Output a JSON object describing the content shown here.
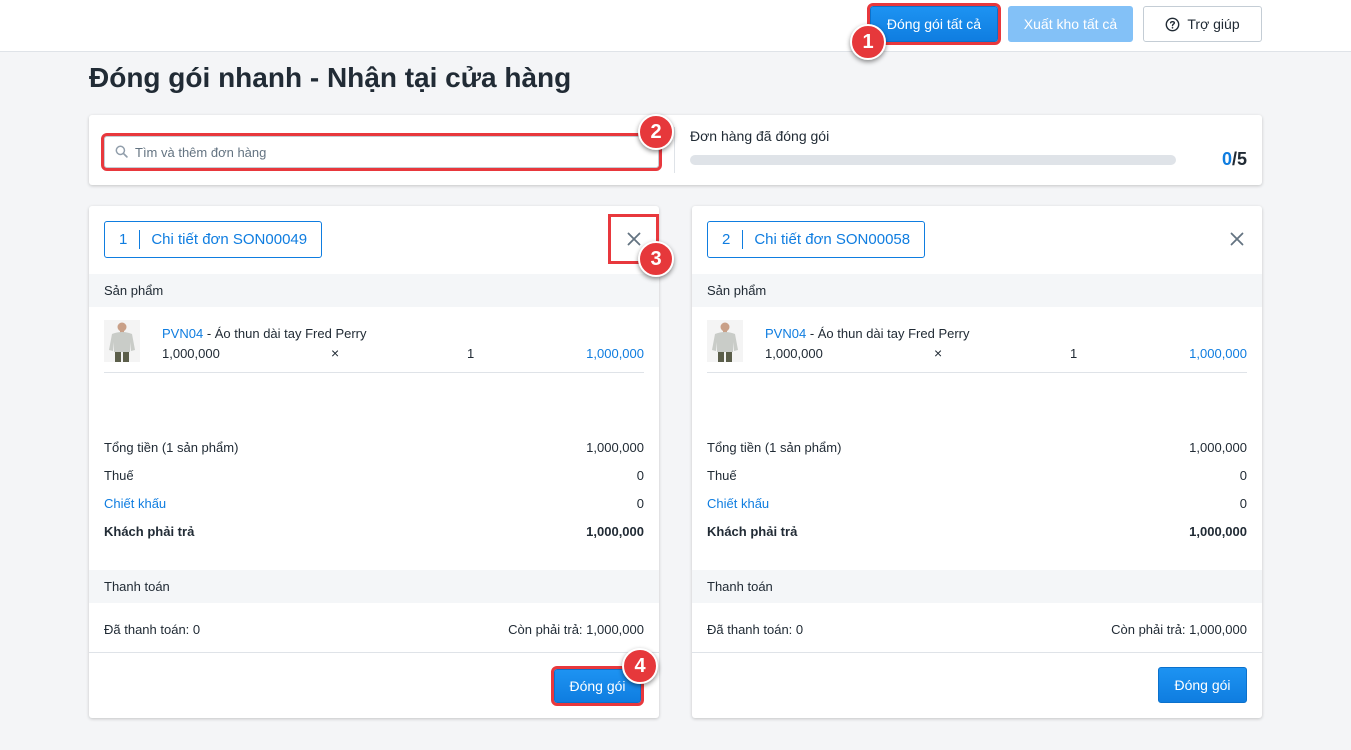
{
  "toolbar": {
    "pack_all": "Đóng gói tất cả",
    "export_all": "Xuất kho tất cả",
    "help": "Trợ giúp"
  },
  "page": {
    "title": "Đóng gói nhanh - Nhận tại cửa hàng"
  },
  "search": {
    "placeholder": "Tìm và thêm đơn hàng"
  },
  "progress": {
    "label": "Đơn hàng đã đóng gói",
    "done": "0",
    "total": "/5",
    "fraction": 0
  },
  "badges": [
    "1",
    "2",
    "3",
    "4"
  ],
  "orders": [
    {
      "index": "1",
      "title": "Chi tiết đơn SON00049",
      "products_label": "Sản phẩm",
      "product": {
        "code": "PVN04",
        "sep": " - ",
        "name": "Áo thun dài tay Fred Perry",
        "price": "1,000,000",
        "times": "×",
        "qty": "1",
        "line_total": "1,000,000"
      },
      "summary": {
        "subtotal_label": "Tổng tiền (1 sản phẩm)",
        "subtotal": "1,000,000",
        "tax_label": "Thuế",
        "tax": "0",
        "discount_label": "Chiết khấu",
        "discount": "0",
        "due_label": "Khách phải trả",
        "due": "1,000,000"
      },
      "payment_label": "Thanh toán",
      "paid": "Đã thanh toán: 0",
      "remaining": "Còn phải trả: 1,000,000",
      "pack_button": "Đóng gói"
    },
    {
      "index": "2",
      "title": "Chi tiết đơn SON00058",
      "products_label": "Sản phẩm",
      "product": {
        "code": "PVN04",
        "sep": " - ",
        "name": "Áo thun dài tay Fred Perry",
        "price": "1,000,000",
        "times": "×",
        "qty": "1",
        "line_total": "1,000,000"
      },
      "summary": {
        "subtotal_label": "Tổng tiền (1 sản phẩm)",
        "subtotal": "1,000,000",
        "tax_label": "Thuế",
        "tax": "0",
        "discount_label": "Chiết khấu",
        "discount": "0",
        "due_label": "Khách phải trả",
        "due": "1,000,000"
      },
      "payment_label": "Thanh toán",
      "paid": "Đã thanh toán: 0",
      "remaining": "Còn phải trả: 1,000,000",
      "pack_button": "Đóng gói"
    }
  ],
  "colors": {
    "primary": "#0f7de0",
    "annotation_red": "#e8383d"
  }
}
